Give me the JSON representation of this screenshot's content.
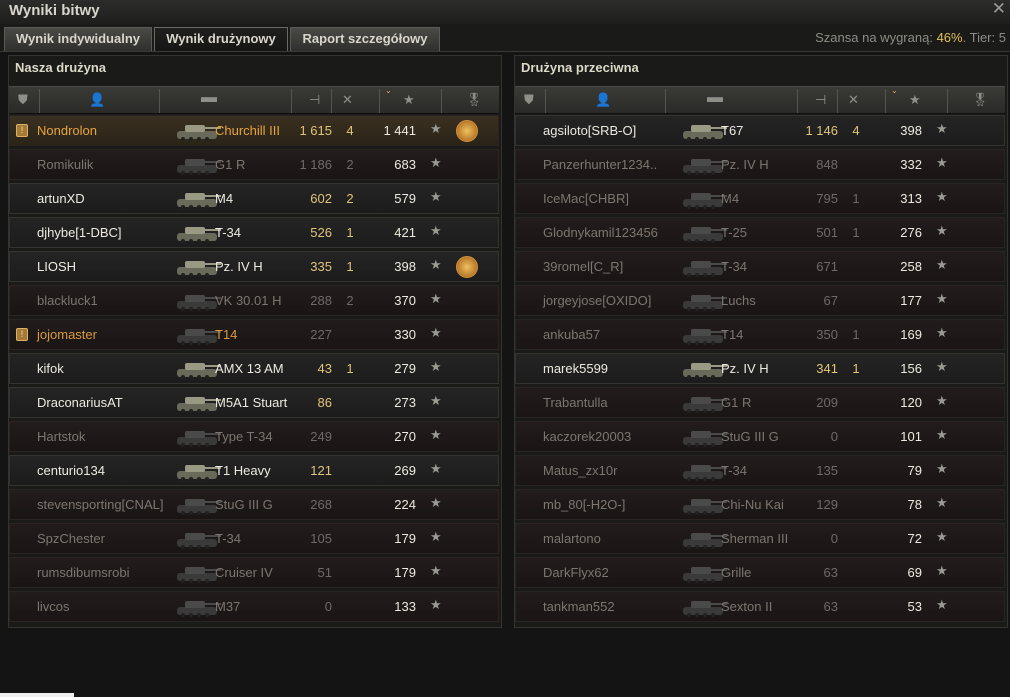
{
  "window": {
    "title": "Wyniki bitwy",
    "close": "✕"
  },
  "tabs": [
    {
      "label": "Wynik indywidualny",
      "active": false
    },
    {
      "label": "Wynik drużynowy",
      "active": true
    },
    {
      "label": "Raport szczegółowy",
      "active": false
    }
  ],
  "chance": {
    "label": "Szansa na wygraną:",
    "value": "46%",
    "sep": ".",
    "tier_label": "Tier:",
    "tier": "5"
  },
  "our_team": {
    "title": "Nasza drużyna",
    "rows": [
      {
        "platoon": true,
        "player": "Nondrolon",
        "tank": "Churchill III",
        "damage": "1 615",
        "kills": "4",
        "xp": "1 441",
        "medal": true,
        "state": "me"
      },
      {
        "platoon": false,
        "player": "Romikulik",
        "tank": "G1 R",
        "damage": "1 186",
        "kills": "2",
        "xp": "683",
        "medal": false,
        "state": "dead"
      },
      {
        "platoon": false,
        "player": "artunXD",
        "tank": "M4",
        "damage": "602",
        "kills": "2",
        "xp": "579",
        "medal": false,
        "state": "alive"
      },
      {
        "platoon": false,
        "player": "djhybe[1-DBC]",
        "tank": "T-34",
        "damage": "526",
        "kills": "1",
        "xp": "421",
        "medal": false,
        "state": "alive"
      },
      {
        "platoon": false,
        "player": "LIOSH",
        "tank": "Pz. IV H",
        "damage": "335",
        "kills": "1",
        "xp": "398",
        "medal": true,
        "state": "alive"
      },
      {
        "platoon": false,
        "player": "blackluck1",
        "tank": "VK 30.01 H",
        "damage": "288",
        "kills": "2",
        "xp": "370",
        "medal": false,
        "state": "dead"
      },
      {
        "platoon": true,
        "player": "jojomaster",
        "tank": "T14",
        "damage": "227",
        "kills": "",
        "xp": "330",
        "medal": false,
        "state": "platoon-dead"
      },
      {
        "platoon": false,
        "player": "kifok",
        "tank": "AMX 13 AM",
        "damage": "43",
        "kills": "1",
        "xp": "279",
        "medal": false,
        "state": "alive"
      },
      {
        "platoon": false,
        "player": "DraconariusAT",
        "tank": "M5A1 Stuart",
        "damage": "86",
        "kills": "",
        "xp": "273",
        "medal": false,
        "state": "alive"
      },
      {
        "platoon": false,
        "player": "Hartstok",
        "tank": "Type T-34",
        "damage": "249",
        "kills": "",
        "xp": "270",
        "medal": false,
        "state": "dead"
      },
      {
        "platoon": false,
        "player": "centurio134",
        "tank": "T1 Heavy",
        "damage": "121",
        "kills": "",
        "xp": "269",
        "medal": false,
        "state": "alive"
      },
      {
        "platoon": false,
        "player": "stevensporting[CNAL]",
        "tank": "StuG III G",
        "damage": "268",
        "kills": "",
        "xp": "224",
        "medal": false,
        "state": "dead"
      },
      {
        "platoon": false,
        "player": "SpzChester",
        "tank": "T-34",
        "damage": "105",
        "kills": "",
        "xp": "179",
        "medal": false,
        "state": "dead"
      },
      {
        "platoon": false,
        "player": "rumsdibumsrobi",
        "tank": "Cruiser IV",
        "damage": "51",
        "kills": "",
        "xp": "179",
        "medal": false,
        "state": "dead"
      },
      {
        "platoon": false,
        "player": "livcos",
        "tank": "M37",
        "damage": "0",
        "kills": "",
        "xp": "133",
        "medal": false,
        "state": "dead"
      }
    ]
  },
  "enemy_team": {
    "title": "Drużyna przeciwna",
    "rows": [
      {
        "player": "agsiloto[SRB-O]",
        "tank": "T67",
        "damage": "1 146",
        "kills": "4",
        "xp": "398",
        "state": "alive"
      },
      {
        "player": "Panzerhunter1234..",
        "tank": "Pz. IV H",
        "damage": "848",
        "kills": "",
        "xp": "332",
        "state": "dead"
      },
      {
        "player": "IceMac[CHBR]",
        "tank": "M4",
        "damage": "795",
        "kills": "1",
        "xp": "313",
        "state": "dead"
      },
      {
        "player": "Glodnykamil123456",
        "tank": "T-25",
        "damage": "501",
        "kills": "1",
        "xp": "276",
        "state": "dead"
      },
      {
        "player": "39romel[C_R]",
        "tank": "T-34",
        "damage": "671",
        "kills": "",
        "xp": "258",
        "state": "dead"
      },
      {
        "player": "jorgeyjose[OXIDO]",
        "tank": "Luchs",
        "damage": "67",
        "kills": "",
        "xp": "177",
        "state": "dead"
      },
      {
        "player": "ankuba57",
        "tank": "T14",
        "damage": "350",
        "kills": "1",
        "xp": "169",
        "state": "dead"
      },
      {
        "player": "marek5599",
        "tank": "Pz. IV H",
        "damage": "341",
        "kills": "1",
        "xp": "156",
        "state": "alive"
      },
      {
        "player": "Trabantulla",
        "tank": "G1 R",
        "damage": "209",
        "kills": "",
        "xp": "120",
        "state": "dead"
      },
      {
        "player": "kaczorek20003",
        "tank": "StuG III G",
        "damage": "0",
        "kills": "",
        "xp": "101",
        "state": "dead"
      },
      {
        "player": "Matus_zx10r",
        "tank": "T-34",
        "damage": "135",
        "kills": "",
        "xp": "79",
        "state": "dead"
      },
      {
        "player": "mb_80[-H2O-]",
        "tank": "Chi-Nu Kai",
        "damage": "129",
        "kills": "",
        "xp": "78",
        "state": "dead"
      },
      {
        "player": "malartono",
        "tank": "Sherman III",
        "damage": "0",
        "kills": "",
        "xp": "72",
        "state": "dead"
      },
      {
        "player": "DarkFlyx62",
        "tank": "Grille",
        "damage": "63",
        "kills": "",
        "xp": "69",
        "state": "dead"
      },
      {
        "player": "tankman552",
        "tank": "Sexton II",
        "damage": "63",
        "kills": "",
        "xp": "53",
        "state": "dead"
      }
    ]
  },
  "icons": {
    "star": "★",
    "sort_arrow": "⌄"
  }
}
